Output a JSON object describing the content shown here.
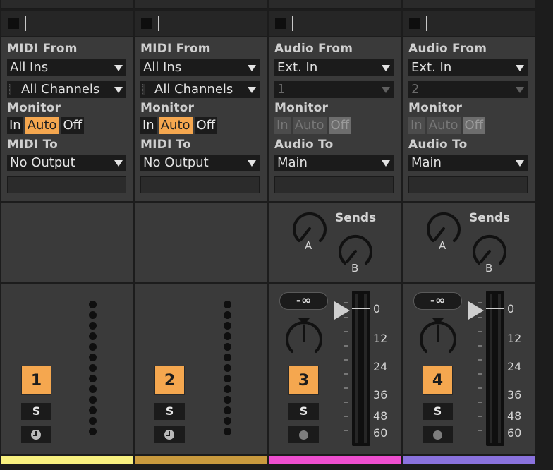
{
  "tracks": [
    {
      "number": "1",
      "color": "#f8f080",
      "input_type_label": "MIDI From",
      "input_source": "All Ins",
      "input_channel": "All Channels",
      "monitor_label": "Monitor",
      "monitor": {
        "in": "In",
        "auto": "Auto",
        "off": "Off",
        "selected": "auto",
        "enabled": true
      },
      "output_label": "MIDI To",
      "output_target": "No Output",
      "solo_label": "S",
      "type": "midi"
    },
    {
      "number": "2",
      "color": "#c99a3e",
      "input_type_label": "MIDI From",
      "input_source": "All Ins",
      "input_channel": "All Channels",
      "monitor_label": "Monitor",
      "monitor": {
        "in": "In",
        "auto": "Auto",
        "off": "Off",
        "selected": "auto",
        "enabled": true
      },
      "output_label": "MIDI To",
      "output_target": "No Output",
      "solo_label": "S",
      "type": "midi"
    },
    {
      "number": "3",
      "color": "#ee4fcf",
      "input_type_label": "Audio From",
      "input_source": "Ext. In",
      "input_channel": "1",
      "monitor_label": "Monitor",
      "monitor": {
        "in": "In",
        "auto": "Auto",
        "off": "Off",
        "selected": "off",
        "enabled": false
      },
      "output_label": "Audio To",
      "output_target": "Main",
      "sends_label": "Sends",
      "send_a": "A",
      "send_b": "B",
      "volume_readout": "-∞",
      "scale": [
        "0",
        "12",
        "24",
        "36",
        "48",
        "60"
      ],
      "solo_label": "S",
      "type": "audio"
    },
    {
      "number": "4",
      "color": "#8a72dd",
      "input_type_label": "Audio From",
      "input_source": "Ext. In",
      "input_channel": "2",
      "monitor_label": "Monitor",
      "monitor": {
        "in": "In",
        "auto": "Auto",
        "off": "Off",
        "selected": "off",
        "enabled": false
      },
      "output_label": "Audio To",
      "output_target": "Main",
      "sends_label": "Sends",
      "send_a": "A",
      "send_b": "B",
      "volume_readout": "-∞",
      "scale": [
        "0",
        "12",
        "24",
        "36",
        "48",
        "60"
      ],
      "solo_label": "S",
      "type": "audio"
    }
  ]
}
